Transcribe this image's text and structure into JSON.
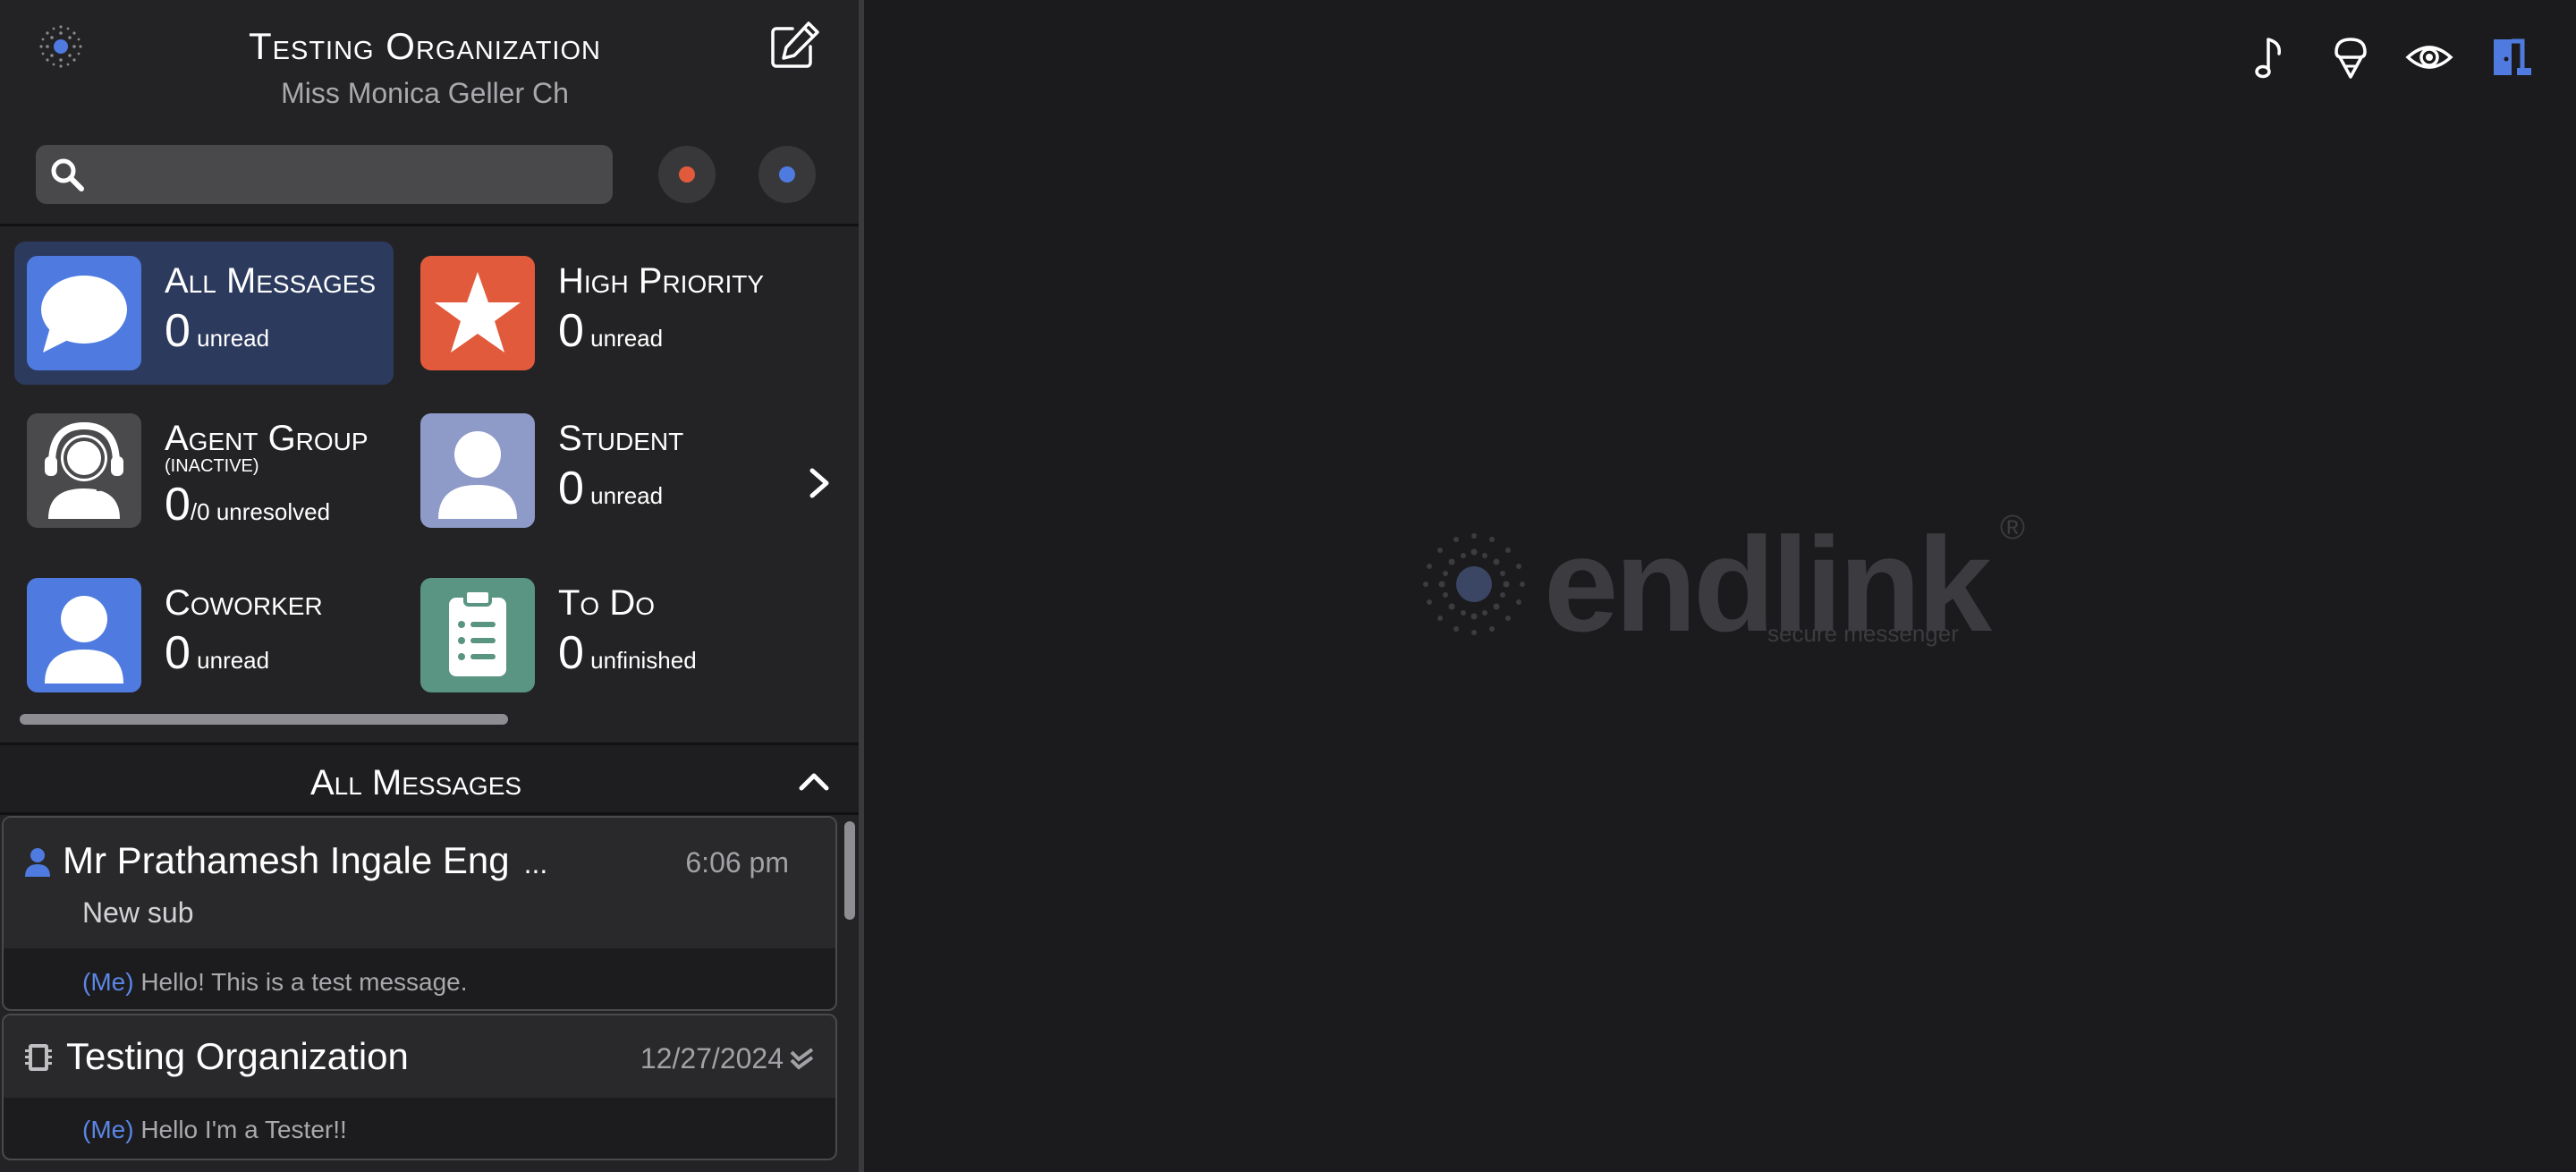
{
  "header": {
    "org_name": "Testing Organization",
    "user_name": "Miss Monica Geller Ch"
  },
  "search": {
    "placeholder": "",
    "value": ""
  },
  "status_colors": {
    "red": "#e25a3c",
    "blue": "#4f7be0"
  },
  "folders": [
    {
      "title": "All Messages",
      "count": "0",
      "count_suffix": " unread",
      "icon": "chat-bubble-icon",
      "color": "#4f7be0",
      "active": true
    },
    {
      "title": "High Priority",
      "count": "0",
      "count_suffix": " unread",
      "icon": "star-icon",
      "color": "#e25a3c",
      "active": false
    },
    {
      "title": "Agent Group",
      "subtitle": "(INACTIVE)",
      "count": "0",
      "count_suffix": "/0 unresolved",
      "icon": "headset-agent-icon",
      "color": "#4a4a4d",
      "active": false
    },
    {
      "title": "Student",
      "count": "0",
      "count_suffix": " unread",
      "icon": "person-icon",
      "color": "#8e9bc8",
      "active": false
    },
    {
      "title": "Coworker",
      "count": "0",
      "count_suffix": " unread",
      "icon": "person-icon",
      "color": "#4f7be0",
      "active": false
    },
    {
      "title": "To Do",
      "count": "0",
      "count_suffix": " unfinished",
      "icon": "clipboard-list-icon",
      "color": "#5a9482",
      "active": false
    }
  ],
  "list": {
    "title": "All Messages",
    "conversations": [
      {
        "name": "Mr Prathamesh Ingale Eng",
        "ellipsis": "...",
        "time": "6:06 pm",
        "subject": "New sub",
        "me_label": "(Me)",
        "preview": " Hello! This is a test message.",
        "icon": "person-icon"
      },
      {
        "name": "Testing Organization",
        "time": "12/27/2024",
        "me_label": "(Me)",
        "preview": " Hello I'm a Tester!!",
        "icon": "building-icon",
        "status_icon": "double-check-icon"
      }
    ]
  },
  "brand": {
    "name": "endlink",
    "registered": "®",
    "tagline": "secure messenger"
  },
  "toolbar_icons": [
    "music-note-icon",
    "ice-cream-icon",
    "eye-icon",
    "logout-door-icon"
  ]
}
